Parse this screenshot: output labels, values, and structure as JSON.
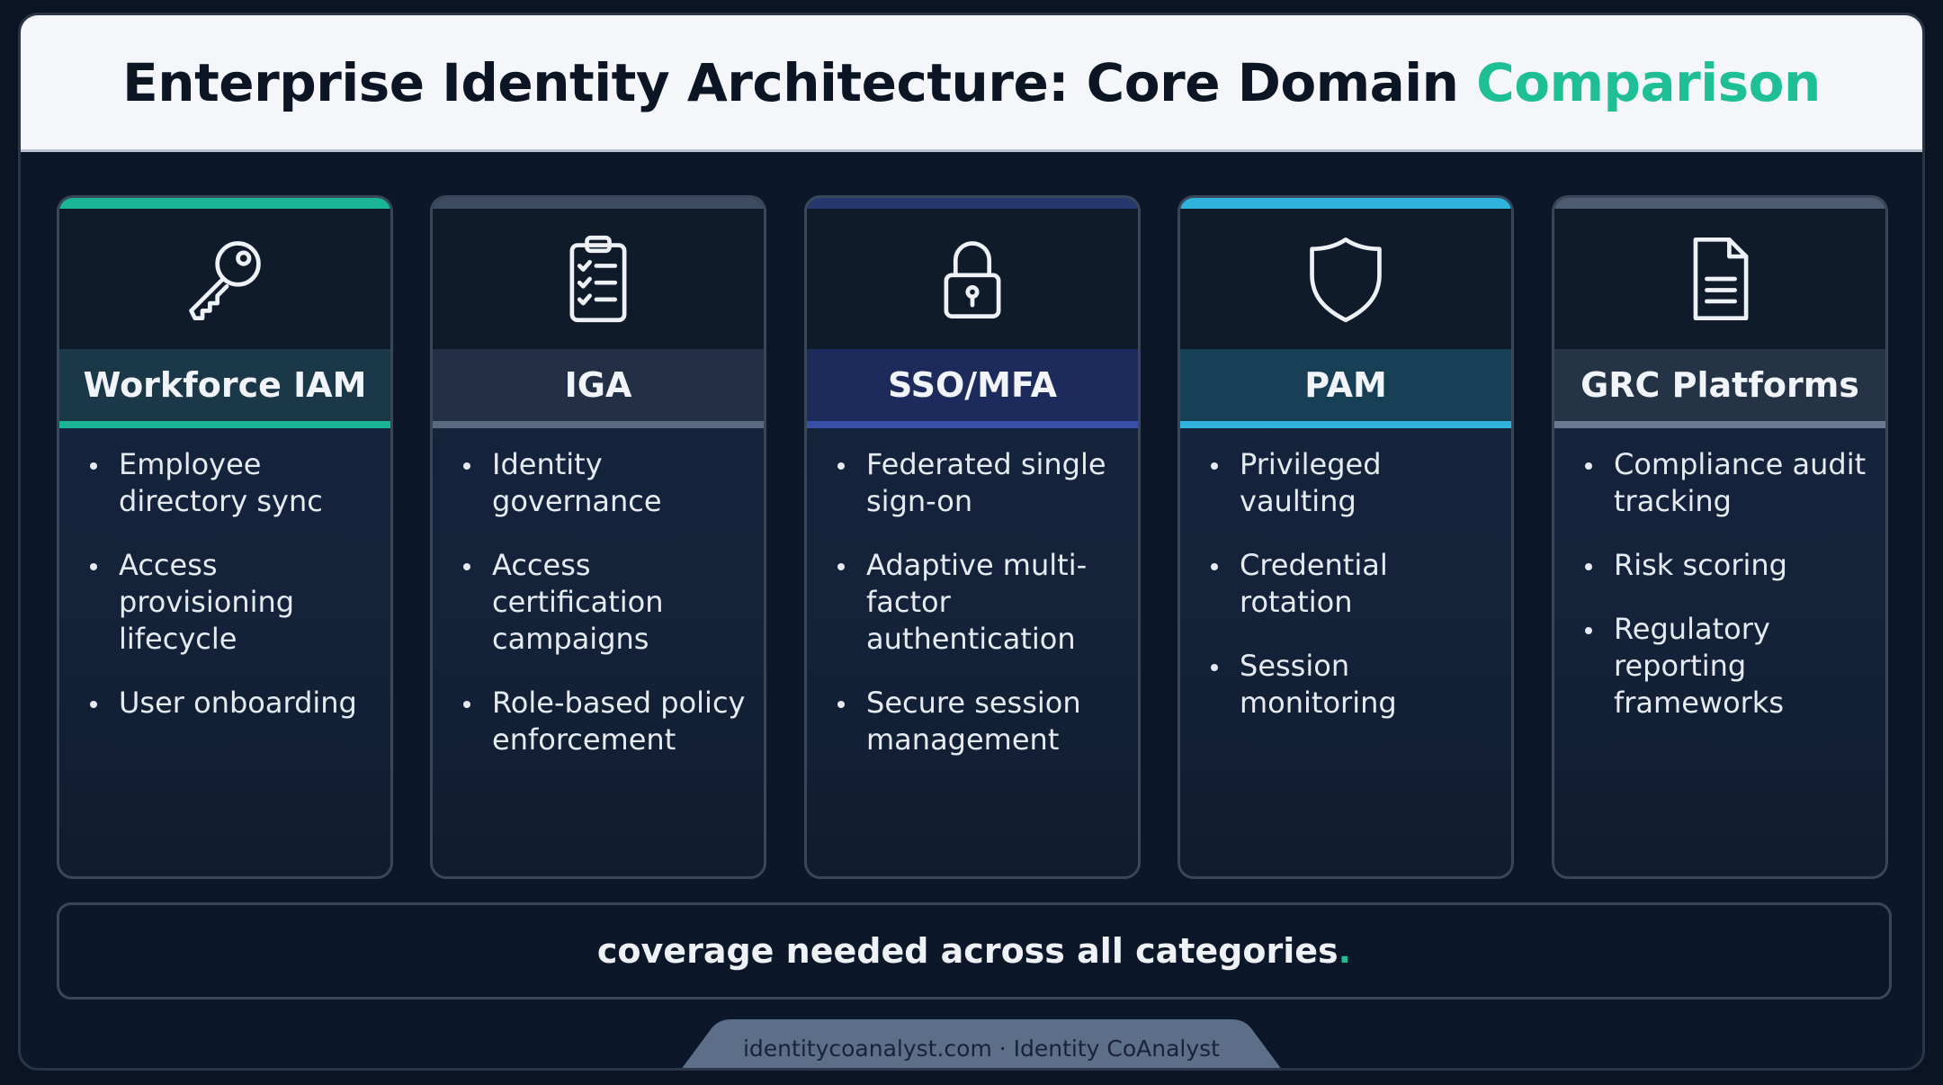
{
  "header": {
    "title_main": "Enterprise Identity Architecture: Core Domain",
    "title_accent": "Comparison",
    "accent_color": "#1fbf96"
  },
  "cards": [
    {
      "name": "Workforce IAM",
      "icon": "key-icon",
      "accent_color": "#1ab596",
      "bullets": [
        "Employee directory sync",
        "Access provisioning lifecycle",
        "User onboarding"
      ]
    },
    {
      "name": "IGA",
      "icon": "clipboard-checklist-icon",
      "accent_color": "#5b6a80",
      "bullets": [
        "Identity governance",
        "Access certification campaigns",
        "Role-based policy enforcement"
      ]
    },
    {
      "name": "SSO/MFA",
      "icon": "padlock-icon",
      "accent_color": "#3950a8",
      "bullets": [
        "Federated single sign-on",
        "Adaptive multi-factor authentication",
        "Secure session management"
      ]
    },
    {
      "name": "PAM",
      "icon": "shield-icon",
      "accent_color": "#2fb3dc",
      "bullets": [
        "Privileged vaulting",
        "Credential rotation",
        "Session monitoring"
      ]
    },
    {
      "name": "GRC Platforms",
      "icon": "document-icon",
      "accent_color": "#6b7a90",
      "bullets": [
        "Compliance audit tracking",
        "Risk scoring",
        "Regulatory reporting frameworks"
      ]
    }
  ],
  "banner": {
    "text": "coverage needed across all categories",
    "period": "."
  },
  "footer": {
    "text": "identitycoanalyst.com · Identity CoAnalyst"
  }
}
